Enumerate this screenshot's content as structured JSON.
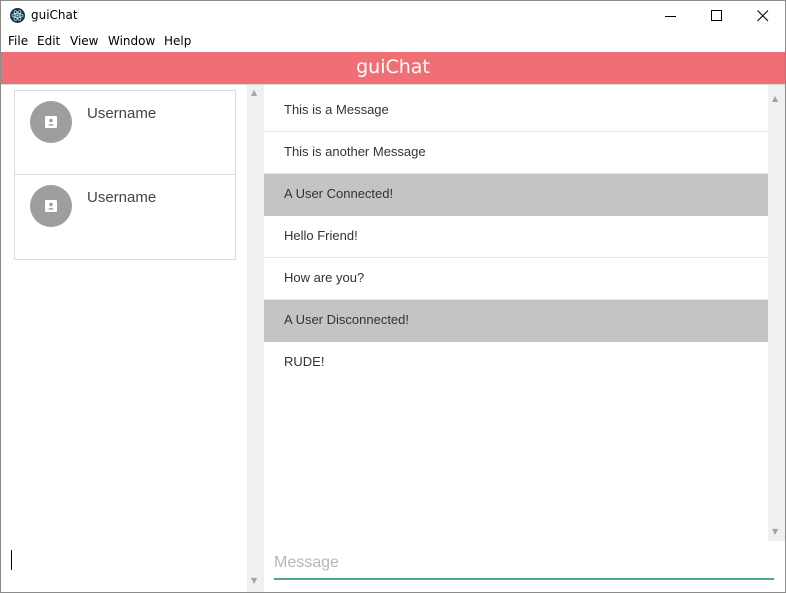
{
  "window": {
    "title": "guiChat",
    "app_icon": "electron-atom-icon",
    "controls": [
      "minimize-icon",
      "maximize-icon",
      "close-icon"
    ]
  },
  "menu": {
    "items": [
      "File",
      "Edit",
      "View",
      "Window",
      "Help"
    ]
  },
  "header": {
    "title": "guiChat",
    "background": "#f06f74"
  },
  "users": [
    {
      "name": "Username",
      "icon": "contact-icon"
    },
    {
      "name": "Username",
      "icon": "contact-icon"
    }
  ],
  "messages": [
    {
      "text": "This is a Message",
      "type": "user"
    },
    {
      "text": "This is another Message",
      "type": "user"
    },
    {
      "text": "A User Connected!",
      "type": "system"
    },
    {
      "text": "Hello Friend!",
      "type": "user"
    },
    {
      "text": "How are you?",
      "type": "user"
    },
    {
      "text": "A User Disconnected!",
      "type": "system"
    },
    {
      "text": "RUDE!",
      "type": "user"
    }
  ],
  "input": {
    "placeholder": "Message",
    "value": "",
    "underline_color": "#4ca798"
  },
  "colors": {
    "system_message_bg": "#c4c4c4",
    "avatar_bg": "#9e9e9e"
  }
}
